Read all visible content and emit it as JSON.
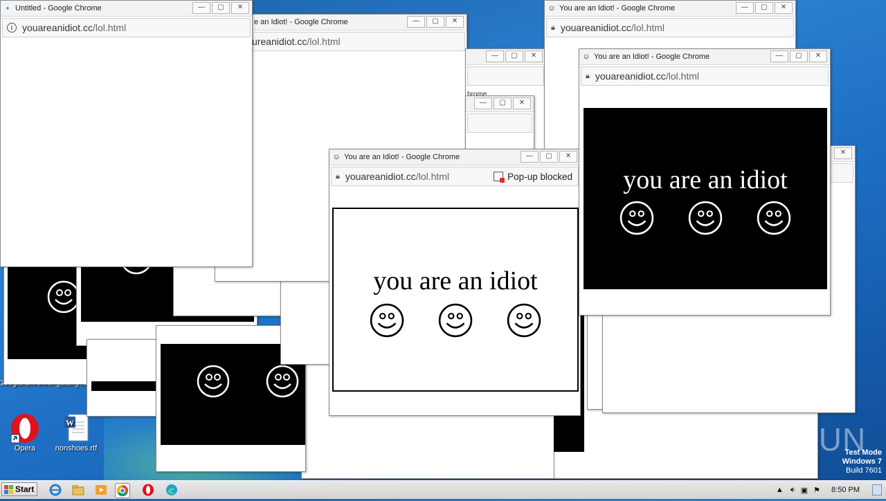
{
  "popup_text": "you are an idiot",
  "url_host": "youareanidiot.cc",
  "url_path": "/lol.html",
  "url_host_partial": "ureanidiot.cc",
  "titles": {
    "untitled": "Untitled - Google Chrome",
    "idiot": "You are an Idiot! - Google Chrome",
    "idiot_partial": "e an Idiot! - Google Chrome",
    "chrome_fragment": "hrome"
  },
  "popup_blocked": "Pop-up blocked",
  "window_controls": {
    "minimize": "—",
    "maximize": "▢",
    "close": "✕"
  },
  "desktop_icons": {
    "chrome": "Google Chrome",
    "getting": "getting ro",
    "opera": "Opera",
    "word": "nonshoes.rtf"
  },
  "taskbar": {
    "start_label": "Start",
    "clock": "8:50 PM",
    "icons": [
      "ie-icon",
      "explorer-icon",
      "media-player-icon",
      "chrome-icon",
      "opera-icon",
      "edge-icon"
    ]
  },
  "watermark": "ANY RUN",
  "test_mode": {
    "line1": "Test Mode",
    "line2": "Windows 7",
    "line3": "Build 7601"
  },
  "colors": {
    "desktop": "#1c6cc2",
    "chrome_frame": "#f1f3f4",
    "popup_bg_dark": "#000000",
    "popup_bg_light": "#ffffff"
  }
}
